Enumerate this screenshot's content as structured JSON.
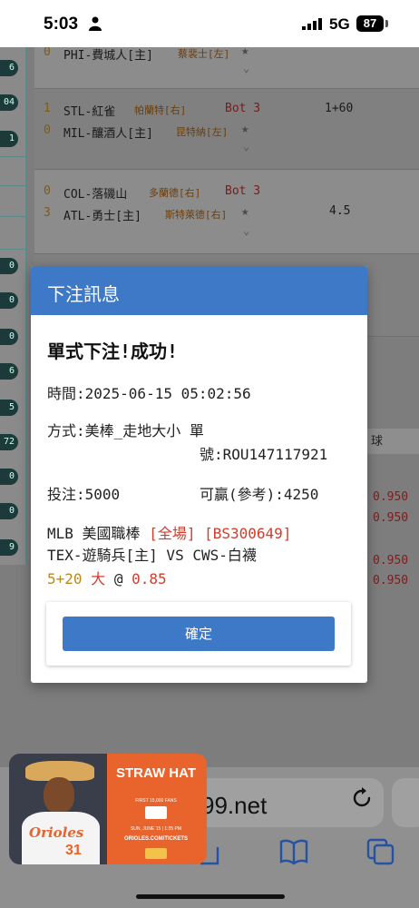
{
  "status_bar": {
    "time": "5:03",
    "network": "5G",
    "battery": "87"
  },
  "left_badges": [
    "6",
    "04",
    "1",
    "0",
    "0",
    "0",
    "6",
    "5",
    "72",
    "0",
    "0",
    "9"
  ],
  "matches": [
    {
      "away_score": "0",
      "away_team": "PHI-費城人[主]",
      "away_pitcher": "蔡裴士[左]"
    },
    {
      "away_score": "1",
      "away_team": "STL-紅雀",
      "away_pitcher": "帕蘭特[右]",
      "inning": "Bot 3",
      "line": "1+60",
      "home_score": "0",
      "home_team": "MIL-釀酒人[主]",
      "home_pitcher": "昆特納[左]"
    },
    {
      "away_score": "0",
      "away_team": "COL-落磯山",
      "away_pitcher": "多蘭德[右]",
      "inning": "Bot 3",
      "line": "4.5",
      "home_score": "3",
      "home_team": "ATL-勇士[主]",
      "home_pitcher": "斯特萊德[右]"
    }
  ],
  "background_odds": [
    "0.950",
    "0.950",
    "0.950",
    "0.950"
  ],
  "background_label": "球",
  "modal": {
    "title": "下注訊息",
    "heading": "單式下注!成功!",
    "time_line": "時間:2025-06-15 05:02:56",
    "method_line": "方式:美棒_走地大小 單",
    "ticket_line": "號:ROU147117921",
    "stake_line": "投注:5000",
    "win_line": "可贏(參考):4250",
    "league": "MLB 美國職棒",
    "period": "[全場]",
    "code": "[BS300649]",
    "matchup": "TEX-遊騎兵[主] VS CWS-白襪",
    "handicap": "5+20",
    "pick": "大",
    "at": "@",
    "odds": "0.85",
    "confirm_label": "確定"
  },
  "browser": {
    "url": "99.net"
  },
  "ad": {
    "headline": "STRAW HAT",
    "subtitle": "FIRST 15,000 FANS",
    "team_script": "Orioles",
    "number": "31",
    "date": "SUN, JUNE 15 | 1:35 PM",
    "url": "ORIOLES.COM/TICKETS"
  }
}
